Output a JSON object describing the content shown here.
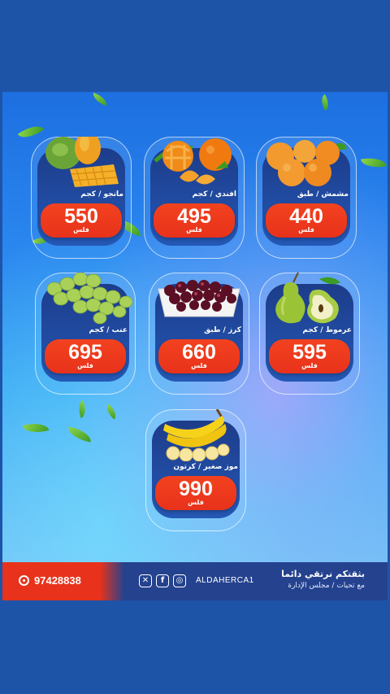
{
  "currency_label": "فلس",
  "products": [
    {
      "name": "مانجو / كجم",
      "price": "550",
      "fruit": "mango-icon"
    },
    {
      "name": "افندي / كجم",
      "price": "495",
      "fruit": "tangerine-icon"
    },
    {
      "name": "مشمش / طبق",
      "price": "440",
      "fruit": "apricot-icon"
    },
    {
      "name": "عنب / كجم",
      "price": "695",
      "fruit": "grapes-icon"
    },
    {
      "name": "كرز / طبق",
      "price": "660",
      "fruit": "cherries-icon"
    },
    {
      "name": "عرموط / كجم",
      "price": "595",
      "fruit": "pear-icon"
    },
    {
      "name": "موز صغير / كرتون",
      "price": "990",
      "fruit": "banana-icon"
    }
  ],
  "footer": {
    "phone": "97428838",
    "handle": "ALDAHERCA1",
    "slogan_line1": "بثقتكم نرتقي دائما",
    "slogan_line2": "مع تحيات / مجلس الإدارة",
    "social": [
      "x-icon",
      "facebook-icon",
      "instagram-icon"
    ]
  },
  "colors": {
    "brand_blue": "#24428e",
    "accent_red": "#e8321b"
  }
}
